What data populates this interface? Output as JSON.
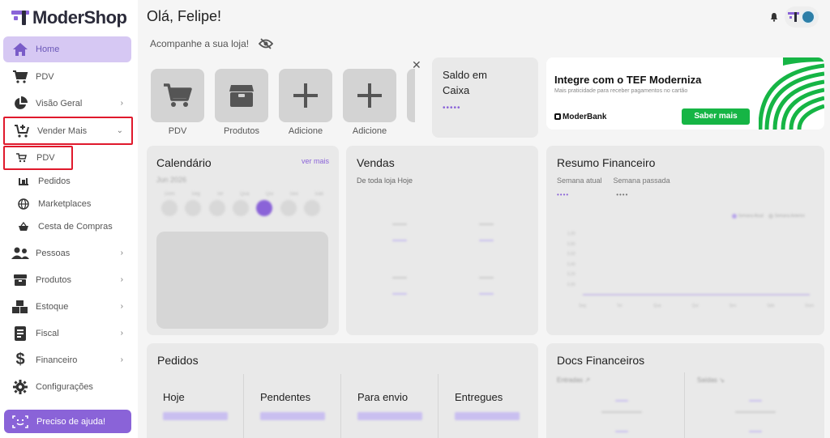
{
  "app": {
    "logo_text": "ModerShop",
    "brand_color": "#8a63d8"
  },
  "sidebar": {
    "items": [
      {
        "label": "Home",
        "icon": "home-icon",
        "active": true
      },
      {
        "label": "PDV",
        "icon": "cart-icon"
      },
      {
        "label": "Visão Geral",
        "icon": "pie-chart-icon",
        "chevron": "›"
      },
      {
        "label": "Vender Mais",
        "icon": "cart-plus-icon",
        "chevron": "⌄"
      }
    ],
    "sub_items": [
      {
        "label": "PDV",
        "icon": "cart-icon"
      },
      {
        "label": "Pedidos",
        "icon": "orders-icon"
      },
      {
        "label": "Marketplaces",
        "icon": "globe-icon"
      },
      {
        "label": "Cesta de Compras",
        "icon": "basket-icon"
      }
    ],
    "items_after": [
      {
        "label": "Pessoas",
        "icon": "people-icon",
        "chevron": "›"
      },
      {
        "label": "Produtos",
        "icon": "box-icon",
        "chevron": "›"
      },
      {
        "label": "Estoque",
        "icon": "boxes-icon",
        "chevron": "›"
      },
      {
        "label": "Fiscal",
        "icon": "receipt-icon",
        "chevron": "›"
      },
      {
        "label": "Financeiro",
        "icon": "dollar-icon",
        "chevron": "›"
      },
      {
        "label": "Configurações",
        "icon": "gear-icon"
      }
    ],
    "help_label": "Preciso de ajuda!"
  },
  "header": {
    "greeting": "Olá, Felipe!",
    "subtitle": "Acompanhe a sua loja!"
  },
  "shortcuts": [
    {
      "label": "PDV",
      "icon": "cart-icon"
    },
    {
      "label": "Produtos",
      "icon": "box-icon"
    },
    {
      "label": "Adicione",
      "icon": "plus-icon"
    },
    {
      "label": "Adicione",
      "icon": "plus-icon"
    }
  ],
  "saldo": {
    "label": "Saldo em Caixa",
    "value": "•••••"
  },
  "banner": {
    "title": "Integre com o TEF Moderniza",
    "subtitle": "Mais praticidade para receber pagamentos no cartão",
    "bank": "ModerBank",
    "button": "Saber mais"
  },
  "calendario": {
    "title": "Calendário",
    "more": "ver mais",
    "month": "Jun 2026",
    "weekdays": [
      "Dom",
      "Seg",
      "Ter",
      "Qua",
      "Qui",
      "Sex",
      "Sáb"
    ]
  },
  "vendas": {
    "title": "Vendas",
    "subtitle": "De toda loja Hoje"
  },
  "resumo": {
    "title": "Resumo Financeiro",
    "tab_current": "Semana atual",
    "tab_previous": "Semana passada",
    "current_value": "••••",
    "previous_value": "••••",
    "legend": [
      "Semana Atual",
      "Semana Anterior"
    ],
    "y_ticks": [
      "1,00",
      "0,80",
      "0,60",
      "0,40",
      "0,20",
      "0,00"
    ],
    "x_ticks": [
      "Seg",
      "Ter",
      "Qua",
      "Qui",
      "Sex",
      "Sáb",
      "Dom"
    ]
  },
  "pedidos": {
    "title": "Pedidos",
    "columns": [
      "Hoje",
      "Pendentes",
      "Para envio",
      "Entregues"
    ]
  },
  "docs": {
    "title": "Docs Financeiros",
    "entradas": "Entradas ↗",
    "saidas": "Saídas ↘"
  }
}
